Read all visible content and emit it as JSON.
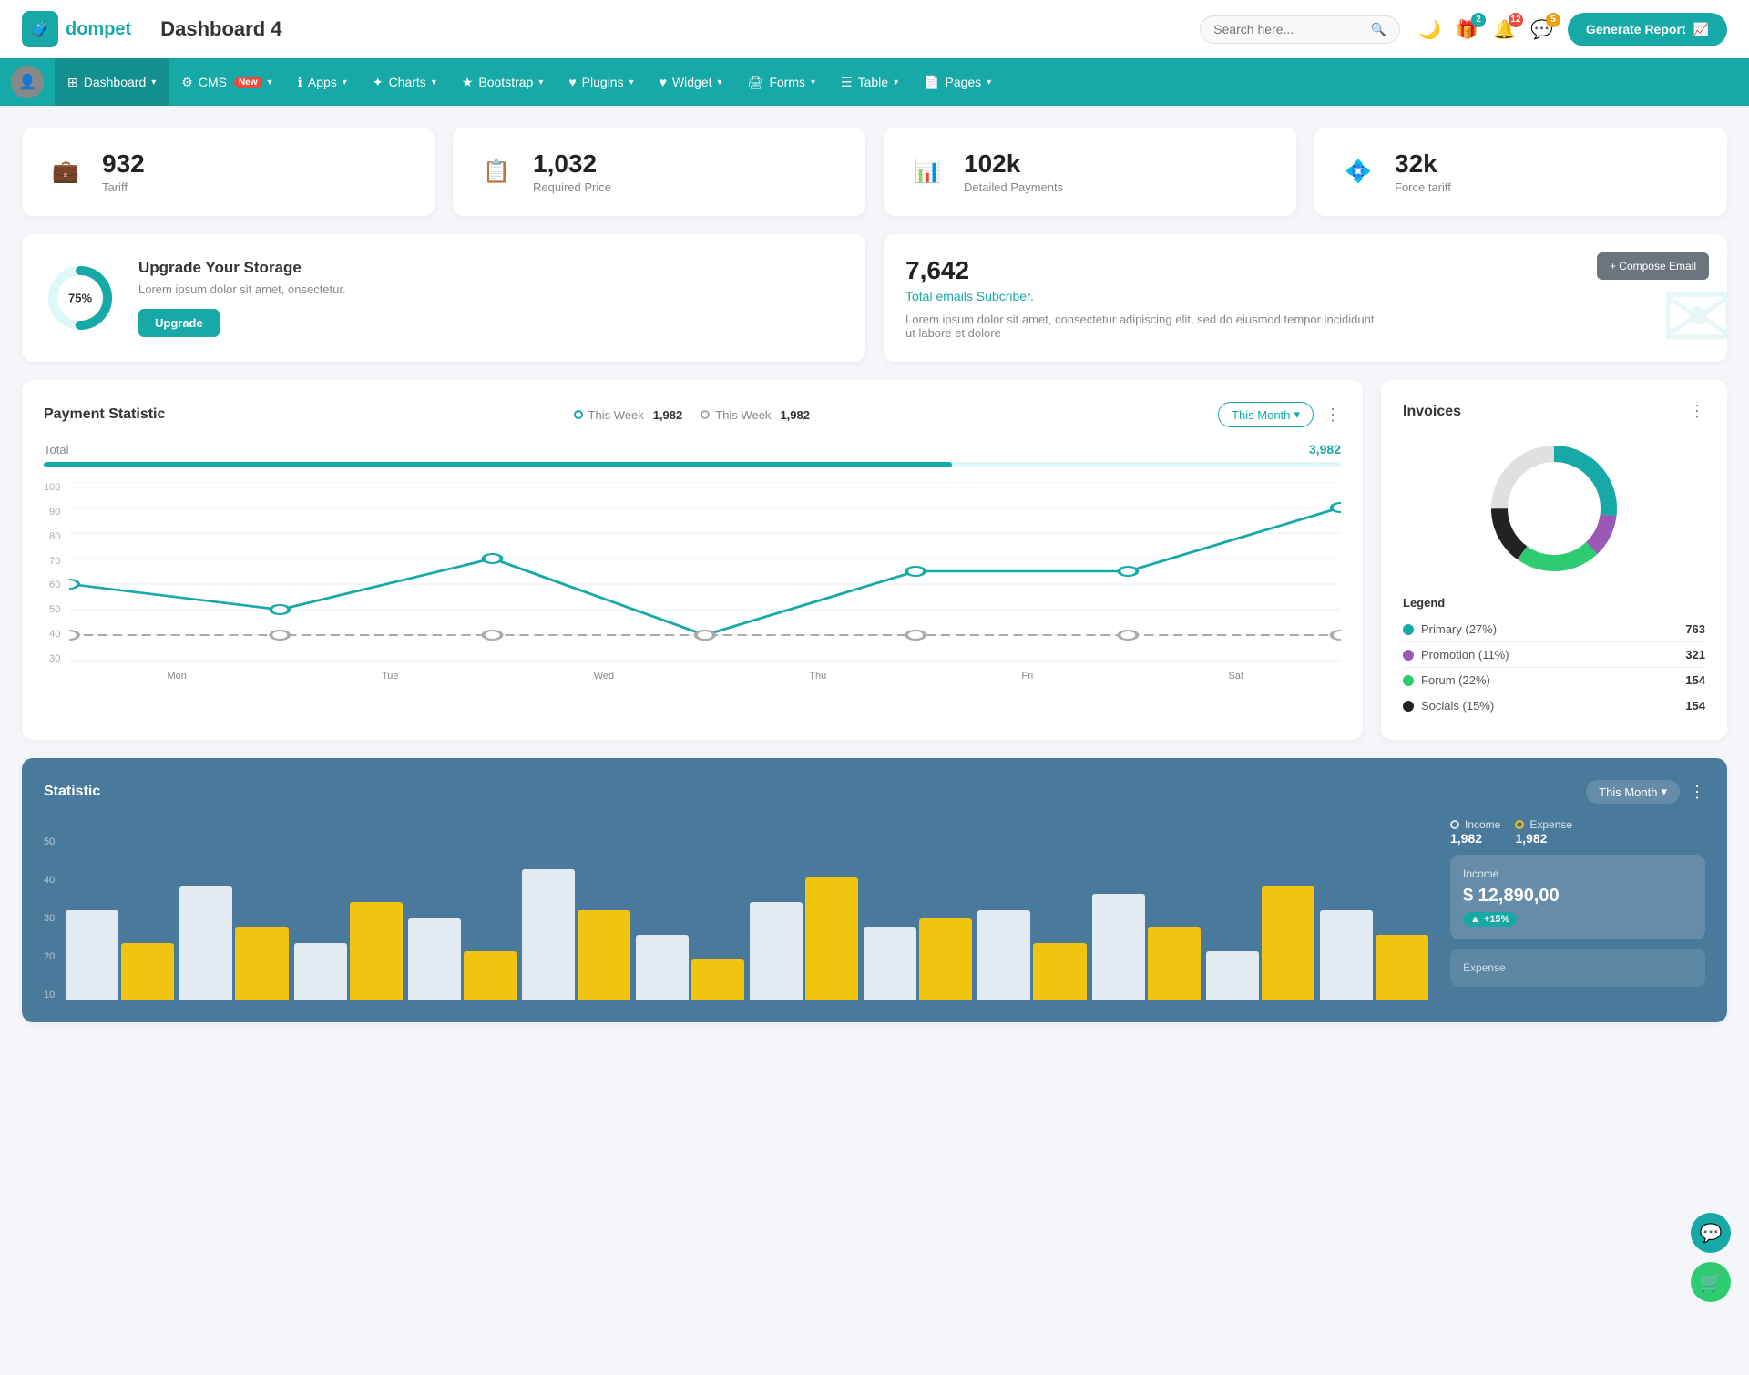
{
  "header": {
    "logo_icon": "🧳",
    "logo_text": "dompet",
    "page_title": "Dashboard 4",
    "search_placeholder": "Search here...",
    "generate_btn": "Generate Report",
    "badge_gift": "2",
    "badge_bell": "12",
    "badge_chat": "5"
  },
  "navbar": {
    "items": [
      {
        "id": "dashboard",
        "label": "Dashboard",
        "icon": "⊞",
        "active": true,
        "has_arrow": true
      },
      {
        "id": "cms",
        "label": "CMS",
        "icon": "⚙",
        "active": false,
        "has_arrow": true,
        "badge": "New"
      },
      {
        "id": "apps",
        "label": "Apps",
        "icon": "ℹ",
        "active": false,
        "has_arrow": true
      },
      {
        "id": "charts",
        "label": "Charts",
        "icon": "✦",
        "active": false,
        "has_arrow": true
      },
      {
        "id": "bootstrap",
        "label": "Bootstrap",
        "icon": "★",
        "active": false,
        "has_arrow": true
      },
      {
        "id": "plugins",
        "label": "Plugins",
        "icon": "♥",
        "active": false,
        "has_arrow": true
      },
      {
        "id": "widget",
        "label": "Widget",
        "icon": "♥",
        "active": false,
        "has_arrow": true
      },
      {
        "id": "forms",
        "label": "Forms",
        "icon": "🖨",
        "active": false,
        "has_arrow": true
      },
      {
        "id": "table",
        "label": "Table",
        "icon": "☰",
        "active": false,
        "has_arrow": true
      },
      {
        "id": "pages",
        "label": "Pages",
        "icon": "📄",
        "active": false,
        "has_arrow": true
      }
    ]
  },
  "stat_cards": [
    {
      "id": "tariff",
      "value": "932",
      "label": "Tariff",
      "icon": "💼",
      "icon_class": "teal"
    },
    {
      "id": "required_price",
      "value": "1,032",
      "label": "Required Price",
      "icon": "📋",
      "icon_class": "red"
    },
    {
      "id": "detailed_payments",
      "value": "102k",
      "label": "Detailed Payments",
      "icon": "📊",
      "icon_class": "blue"
    },
    {
      "id": "force_tariff",
      "value": "32k",
      "label": "Force tariff",
      "icon": "💠",
      "icon_class": "pink"
    }
  ],
  "storage": {
    "percent": "75%",
    "title": "Upgrade Your Storage",
    "desc": "Lorem ipsum dolor sit amet, onsectetur.",
    "btn": "Upgrade"
  },
  "email": {
    "count": "7,642",
    "subtitle": "Total emails Subcriber.",
    "desc": "Lorem ipsum dolor sit amet, consectetur adipiscing elit, sed do eiusmod tempor incididunt ut labore et dolore",
    "compose_btn": "+ Compose Email"
  },
  "payment_chart": {
    "title": "Payment Statistic",
    "this_week_1_label": "This Week",
    "this_week_1_value": "1,982",
    "this_week_2_label": "This Week",
    "this_week_2_value": "1,982",
    "filter": "This Month",
    "total_label": "Total",
    "total_value": "3,982",
    "x_labels": [
      "Mon",
      "Tue",
      "Wed",
      "Thu",
      "Fri",
      "Sat"
    ],
    "y_labels": [
      "100",
      "90",
      "80",
      "70",
      "60",
      "50",
      "40",
      "30"
    ],
    "line1": [
      60,
      50,
      70,
      40,
      65,
      65,
      90
    ],
    "line2": [
      40,
      40,
      40,
      40,
      40,
      40,
      40
    ]
  },
  "invoices": {
    "title": "Invoices",
    "donut": {
      "segments": [
        {
          "color": "#17a8a8",
          "pct": 27,
          "label": "Primary (27%)",
          "value": "763"
        },
        {
          "color": "#9b59b6",
          "pct": 11,
          "label": "Promotion (11%)",
          "value": "321"
        },
        {
          "color": "#2ecc71",
          "pct": 22,
          "label": "Forum (22%)",
          "value": "154"
        },
        {
          "color": "#222",
          "pct": 15,
          "label": "Socials (15%)",
          "value": "154"
        }
      ]
    },
    "legend_title": "Legend"
  },
  "statistic": {
    "title": "Statistic",
    "filter": "This Month",
    "income_label": "Income",
    "income_value": "1,982",
    "expense_label": "Expense",
    "expense_value": "1,982",
    "income_box_label": "Income",
    "income_amount": "$ 12,890,00",
    "income_badge": "+15%",
    "expense_box_label": "Expense",
    "y_labels": [
      "50",
      "40",
      "30",
      "20",
      "10"
    ],
    "bars": [
      {
        "white": 55,
        "yellow": 35
      },
      {
        "white": 70,
        "yellow": 45
      },
      {
        "white": 35,
        "yellow": 60
      },
      {
        "white": 50,
        "yellow": 30
      },
      {
        "white": 80,
        "yellow": 55
      },
      {
        "white": 40,
        "yellow": 25
      },
      {
        "white": 60,
        "yellow": 75
      },
      {
        "white": 45,
        "yellow": 50
      },
      {
        "white": 55,
        "yellow": 35
      },
      {
        "white": 65,
        "yellow": 45
      },
      {
        "white": 30,
        "yellow": 70
      },
      {
        "white": 55,
        "yellow": 40
      }
    ]
  }
}
